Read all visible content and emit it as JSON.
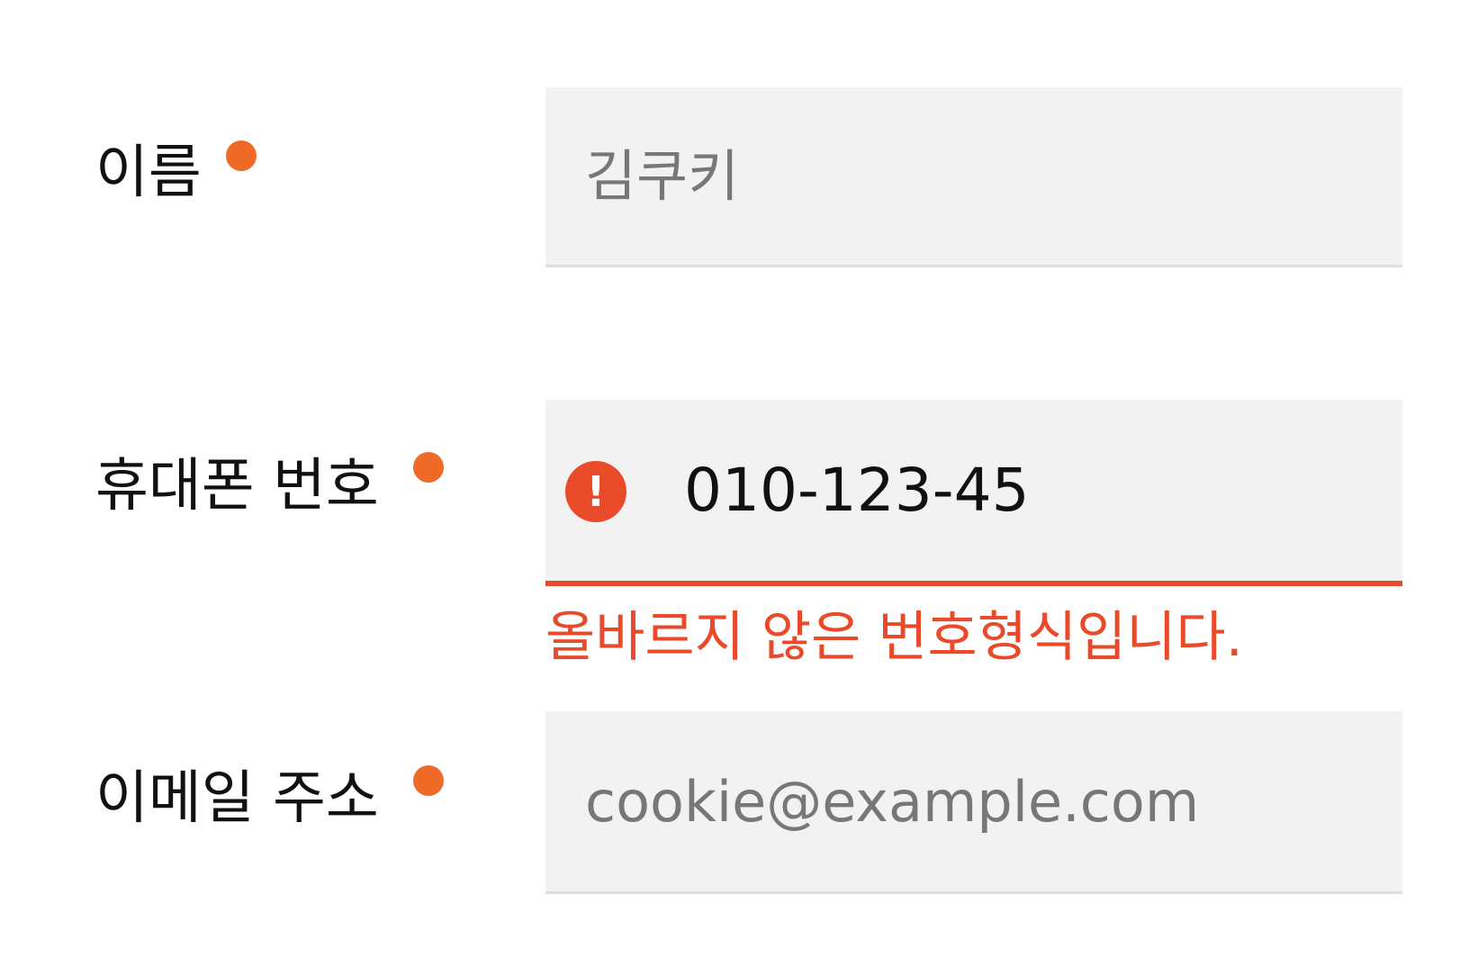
{
  "form": {
    "name": {
      "label": "이름",
      "placeholder": "김쿠키",
      "value": ""
    },
    "phone": {
      "label": "휴대폰 번호",
      "placeholder": "",
      "value": "010-123-45",
      "error_message": "올바르지 않은 번호형식입니다."
    },
    "email": {
      "label": "이메일 주소",
      "placeholder": "cookie@example.com",
      "value": ""
    }
  },
  "icons": {
    "required": "required-dot-icon",
    "error": "exclamation-circle-icon"
  },
  "colors": {
    "required_dot": "#ef6a26",
    "error": "#e84a2a",
    "field_background": "#f2f2f2",
    "placeholder": "#777777",
    "text": "#111111"
  }
}
